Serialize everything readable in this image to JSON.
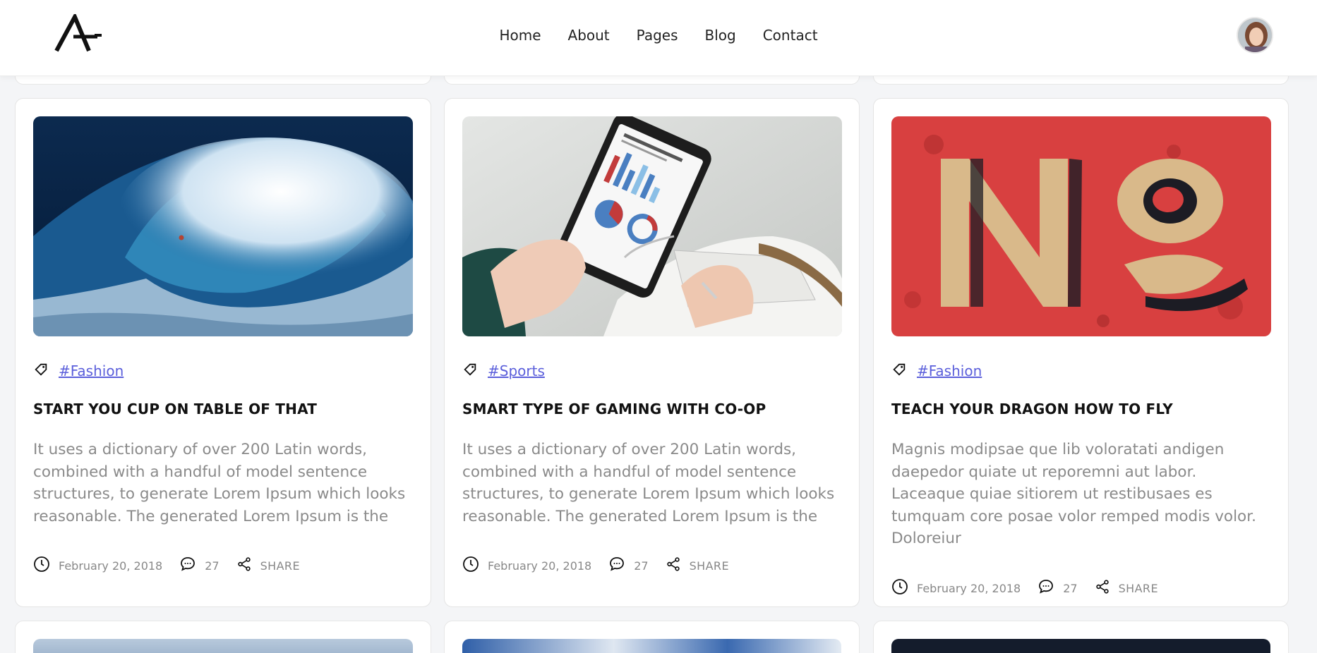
{
  "nav": {
    "items": [
      {
        "label": "Home"
      },
      {
        "label": "About"
      },
      {
        "label": "Pages"
      },
      {
        "label": "Blog"
      },
      {
        "label": "Contact"
      }
    ]
  },
  "cards": [
    {
      "tag": "#Fashion",
      "title": "START YOU CUP ON TABLE OF THAT",
      "excerpt": "It uses a dictionary of over 200 Latin words, combined with a handful of model sentence structures, to generate Lorem Ipsum which looks reasonable. The generated Lorem Ipsum is the",
      "date": "February 20, 2018",
      "comments": "27",
      "share": "SHARE",
      "image": "ocean-wave-surfer"
    },
    {
      "tag": "#Sports",
      "title": "SMART TYPE OF GAMING WITH CO-OP",
      "excerpt": "It uses a dictionary of over 200 Latin words, combined with a handful of model sentence structures, to generate Lorem Ipsum which looks reasonable. The generated Lorem Ipsum is the",
      "date": "February 20, 2018",
      "comments": "27",
      "share": "SHARE",
      "image": "phone-marketing-chart"
    },
    {
      "tag": "#Fashion",
      "title": "TEACH YOUR DRAGON HOW TO FLY",
      "excerpt": "Magnis modipsae que lib voloratati andigen daepedor quiate ut reporemni aut labor. Laceaque quiae sitiorem ut restibusaes es tumquam core posae volor remped modis volor. Doloreiur",
      "date": "February 20, 2018",
      "comments": "27",
      "share": "SHARE",
      "image": "painted-no-sign"
    }
  ],
  "icons": {
    "tag": "tag-icon",
    "clock": "clock-icon",
    "comment": "comment-icon",
    "share": "share-icon"
  },
  "colors": {
    "accent": "#5b5fdb",
    "muted_text": "#8a8a8a"
  }
}
